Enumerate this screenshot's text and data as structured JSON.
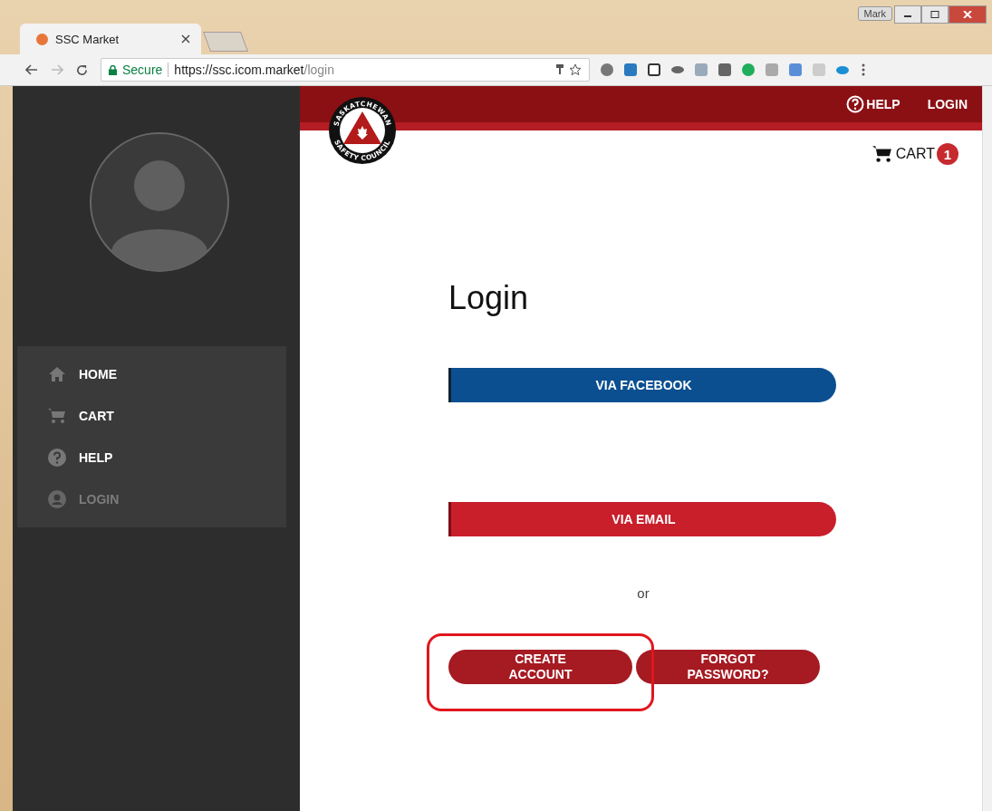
{
  "browser": {
    "tab_title": "SSC Market",
    "user": "Mark",
    "secure_label": "Secure",
    "url_host": "https://ssc.icom.market",
    "url_path": "/login"
  },
  "sidebar": {
    "items": [
      {
        "label": "HOME",
        "selected": false
      },
      {
        "label": "CART",
        "selected": false
      },
      {
        "label": "HELP",
        "selected": false
      },
      {
        "label": "LOGIN",
        "selected": true
      }
    ]
  },
  "header": {
    "logo_top": "SASKATCHEWAN",
    "logo_bottom": "SAFETY COUNCIL",
    "help": "HELP",
    "login": "LOGIN",
    "cart": "CART",
    "cart_count": "1"
  },
  "login": {
    "title": "Login",
    "facebook": "VIA FACEBOOK",
    "email": "VIA EMAIL",
    "or": "or",
    "create": "CREATE ACCOUNT",
    "forgot": "FORGOT PASSWORD?"
  }
}
